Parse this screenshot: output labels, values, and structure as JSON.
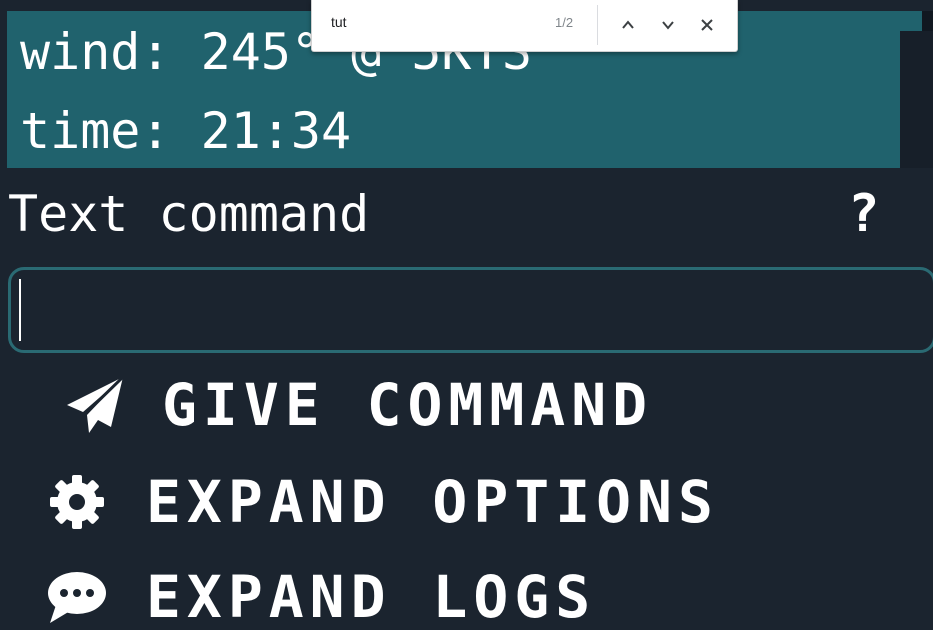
{
  "status": {
    "wind_line": "wind: 245° @ 5KTS",
    "time_line": "time: 21:34"
  },
  "command": {
    "label": "Text command",
    "help": "?",
    "input_value": "",
    "input_placeholder": ""
  },
  "actions": {
    "give_label": "GIVE COMMAND",
    "options_label": "EXPAND OPTIONS",
    "logs_label": "EXPAND LOGS"
  },
  "icons": {
    "give": "paper-plane-icon",
    "options": "gear-icon",
    "logs": "chat-bubble-icon"
  },
  "findbar": {
    "query": "tut",
    "count": "1/2"
  },
  "colors": {
    "background": "#1b242f",
    "panel": "#20626d",
    "input_border": "#2a6a73",
    "text": "#ffffff"
  }
}
